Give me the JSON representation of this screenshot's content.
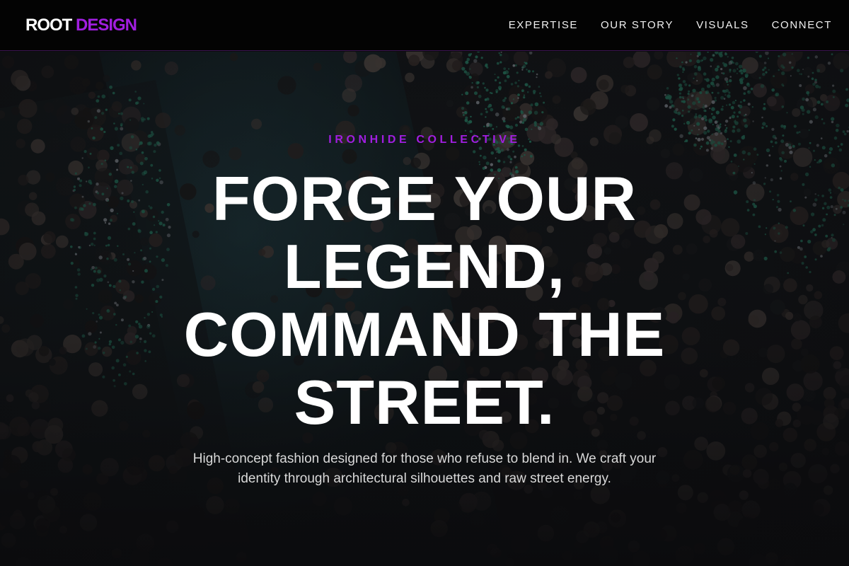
{
  "brand": {
    "logo_part1": "ROOT",
    "logo_part2": "DESIGN",
    "accent_color": "#a11ee0"
  },
  "nav": {
    "items": [
      {
        "label": "EXPERTISE"
      },
      {
        "label": "OUR STORY"
      },
      {
        "label": "VISUALS"
      },
      {
        "label": "CONNECT"
      }
    ]
  },
  "hero": {
    "background_image": "overhead view of a crowded runway show with teal floor and green ornamental light decorations",
    "eyebrow": "IRONHIDE COLLECTIVE",
    "headline_lines": [
      "FORGE YOUR",
      "LEGEND,",
      "COMMAND THE",
      "STREET."
    ],
    "subcopy": "High-concept fashion designed for those who refuse to blend in. We craft your identity through architectural silhouettes and raw street energy."
  }
}
